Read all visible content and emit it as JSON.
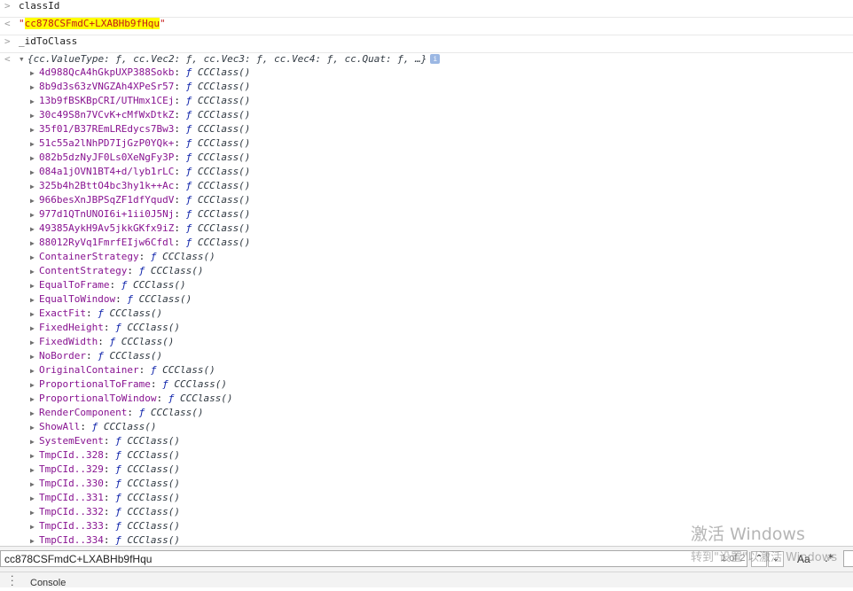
{
  "console": {
    "cmd1": "classId",
    "result1": "cc878CSFmdC+LXABHb9fHqu",
    "cmd2": "_idToClass",
    "object_preview": "{cc.ValueType: ƒ, cc.Vec2: ƒ, cc.Vec3: ƒ, cc.Vec4: ƒ, cc.Quat: ƒ, …}",
    "info_icon": "info-icon",
    "fn_glyph": "ƒ",
    "fn_value": "CCClass()",
    "properties": [
      "4d988QcA4hGkpUXP388Sokb",
      "8b9d3s63zVNGZAh4XPeSr57",
      "13b9fBSKBpCRI/UTHmx1CEj",
      "30c49S8n7VCvK+cMfWxDtkZ",
      "35f01/B37REmLREdycs7Bw3",
      "51c55a2lNhPD7IjGzP0YQk+",
      "082b5dzNyJF0Ls0XeNgFy3P",
      "084a1jOVN1BT4+d/lyb1rLC",
      "325b4h2BttO4bc3hy1k++Ac",
      "966besXnJBPSqZF1dfYqudV",
      "977d1QTnUNOI6i+1ii0J5Nj",
      "49385AykH9Av5jkkGKfx9iZ",
      "88012RyVq1FmrfEIjw6Cfdl",
      "ContainerStrategy",
      "ContentStrategy",
      "EqualToFrame",
      "EqualToWindow",
      "ExactFit",
      "FixedHeight",
      "FixedWidth",
      "NoBorder",
      "OriginalContainer",
      "ProportionalToFrame",
      "ProportionalToWindow",
      "RenderComponent",
      "ShowAll",
      "SystemEvent",
      "TmpCId..328",
      "TmpCId..329",
      "TmpCId..330",
      "TmpCId..331",
      "TmpCId..332",
      "TmpCId..333",
      "TmpCId..334"
    ]
  },
  "search": {
    "value": "cc878CSFmdC+LXABHb9fHqu",
    "match_count": "1 of 2",
    "case_label": "Aa",
    "prev_icon": "chevron-up-icon",
    "next_icon": "chevron-down-icon"
  },
  "drawer": {
    "tab_label": "Console"
  },
  "watermark": {
    "line1": "激活 Windows",
    "line2": "转到\"设置\"以激活 Windows"
  }
}
